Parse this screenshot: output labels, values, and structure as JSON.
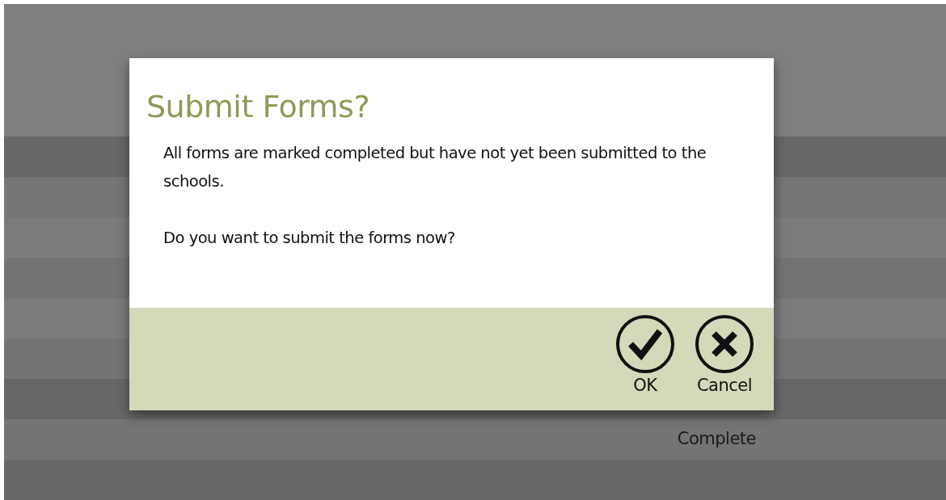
{
  "dialog": {
    "title": "Submit Forms?",
    "paragraphs": [
      "All forms are marked completed but have not yet been submitted to the schools.",
      "Do you want to submit the forms now?"
    ],
    "buttons": [
      {
        "label": "OK",
        "kind": "ok"
      },
      {
        "label": "Cancel",
        "kind": "cancel"
      }
    ]
  },
  "background_rows": [
    {
      "status": "Complete"
    }
  ]
}
